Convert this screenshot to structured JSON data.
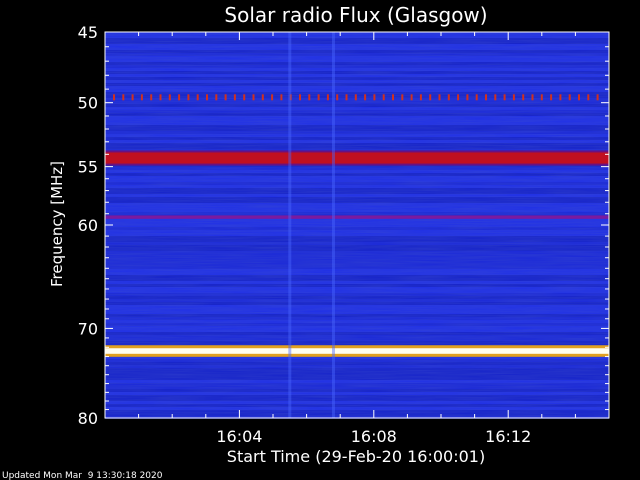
{
  "footer": {
    "updated": "Updated Mon Mar  9 13:30:18 2020"
  },
  "colors": {
    "background": "#000000",
    "axes": "#ffffff",
    "spectrogram_base": "#1a28e0",
    "band_red": "#c01020",
    "band_white": "#fffef0"
  },
  "chart_data": {
    "type": "heatmap",
    "title": "Solar radio Flux (Glasgow)",
    "xlabel": "Start Time (29-Feb-20 16:00:01)",
    "ylabel": "Frequency [MHz]",
    "x_range_minutes": [
      0,
      15
    ],
    "x_ticks": [
      {
        "minute": 4,
        "label": "16:04"
      },
      {
        "minute": 8,
        "label": "16:08"
      },
      {
        "minute": 12,
        "label": "16:12"
      }
    ],
    "y_scale": "log",
    "ylim": [
      45,
      80
    ],
    "y_direction": "down",
    "y_ticks": [
      {
        "mhz": 45,
        "label": "45"
      },
      {
        "mhz": 50,
        "label": "50"
      },
      {
        "mhz": 55,
        "label": "55"
      },
      {
        "mhz": 60,
        "label": "60"
      },
      {
        "mhz": 70,
        "label": "70"
      },
      {
        "mhz": 80,
        "label": "80"
      }
    ],
    "bands": [
      {
        "mhz": 49.6,
        "width_mhz": 0.5,
        "intensity": "pulsed-red"
      },
      {
        "mhz": 54.3,
        "width_mhz": 0.9,
        "intensity": "red"
      },
      {
        "mhz": 59.3,
        "width_mhz": 0.3,
        "intensity": "purple"
      },
      {
        "mhz": 72.4,
        "width_mhz": 0.6,
        "intensity": "white"
      }
    ],
    "vertical_streaks_minute": [
      5.5,
      6.8
    ]
  }
}
